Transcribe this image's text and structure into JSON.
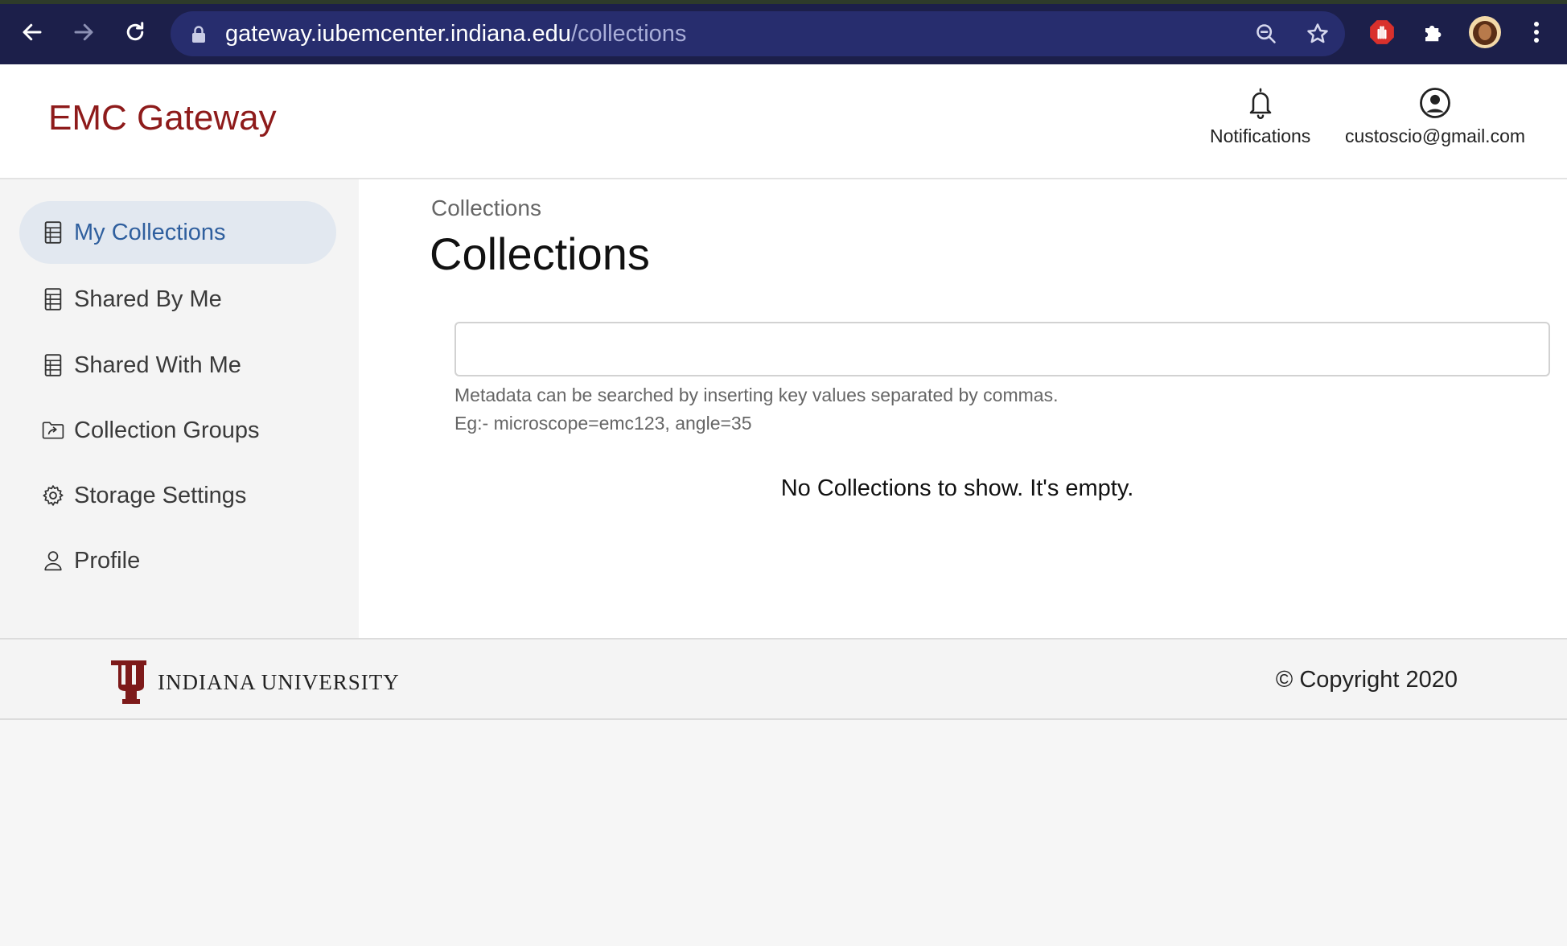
{
  "browser": {
    "url_host": "gateway.iubemcenter.indiana.edu",
    "url_path": "/collections"
  },
  "header": {
    "brand": "EMC Gateway",
    "notifications_label": "Notifications",
    "user_email": "custoscio@gmail.com"
  },
  "sidebar": {
    "items": [
      {
        "label": "My Collections",
        "icon": "spreadsheet-icon",
        "active": true
      },
      {
        "label": "Shared By Me",
        "icon": "spreadsheet-icon",
        "active": false
      },
      {
        "label": "Shared With Me",
        "icon": "spreadsheet-icon",
        "active": false
      },
      {
        "label": "Collection Groups",
        "icon": "folder-share-icon",
        "active": false
      },
      {
        "label": "Storage Settings",
        "icon": "gear-icon",
        "active": false
      },
      {
        "label": "Profile",
        "icon": "person-icon",
        "active": false
      }
    ]
  },
  "main": {
    "breadcrumb": "Collections",
    "title": "Collections",
    "search": {
      "value": "",
      "placeholder": ""
    },
    "hint_line1": "Metadata can be searched by inserting key values separated by commas.",
    "hint_line2": "Eg:- microscope=emc123, angle=35",
    "empty_message": "No Collections to show. It's empty."
  },
  "footer": {
    "institution": "INDIANA UNIVERSITY",
    "copyright": "© Copyright 2020"
  },
  "colors": {
    "brand": "#8e1b1b",
    "active_nav_bg": "#e2e8f0",
    "active_nav_text": "#2f5f9e",
    "chrome_bg": "#1c1f4a"
  }
}
